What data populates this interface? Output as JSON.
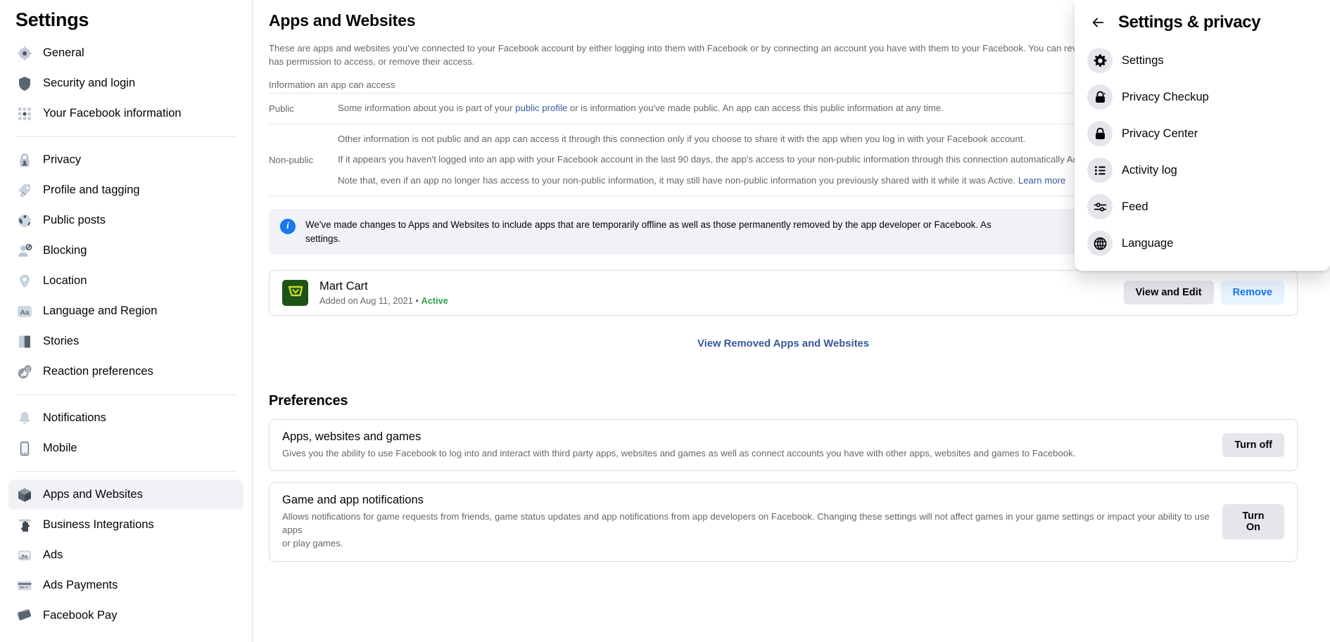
{
  "sidebar": {
    "title": "Settings",
    "groups": [
      {
        "items": [
          {
            "label": "General",
            "icon": "gear-icon"
          },
          {
            "label": "Security and login",
            "icon": "shield-icon"
          },
          {
            "label": "Your Facebook information",
            "icon": "grid-dots-icon"
          }
        ]
      },
      {
        "items": [
          {
            "label": "Privacy",
            "icon": "lock-person-icon"
          },
          {
            "label": "Profile and tagging",
            "icon": "tag-icon"
          },
          {
            "label": "Public posts",
            "icon": "globe-icon"
          },
          {
            "label": "Blocking",
            "icon": "person-block-icon"
          },
          {
            "label": "Location",
            "icon": "map-pin-icon"
          },
          {
            "label": "Language and Region",
            "icon": "aa-text-icon"
          },
          {
            "label": "Stories",
            "icon": "book-icon"
          },
          {
            "label": "Reaction preferences",
            "icon": "thumbs-up-icon"
          }
        ]
      },
      {
        "items": [
          {
            "label": "Notifications",
            "icon": "bell-icon"
          },
          {
            "label": "Mobile",
            "icon": "phone-icon"
          }
        ]
      },
      {
        "items": [
          {
            "label": "Apps and Websites",
            "icon": "cube-icon",
            "active": true
          },
          {
            "label": "Business Integrations",
            "icon": "puzzle-icon"
          },
          {
            "label": "Ads",
            "icon": "ad-image-icon"
          },
          {
            "label": "Ads Payments",
            "icon": "credit-card-icon"
          },
          {
            "label": "Facebook Pay",
            "icon": "wallet-icon"
          }
        ]
      }
    ]
  },
  "main": {
    "page_title": "Apps and Websites",
    "page_description": "These are apps and websites you've connected to your Facebook account by either logging into them with Facebook or by connecting an account you have with them to your Facebook. You can review\nhas permission to access, or remove their access.",
    "info_subhead": "Information an app can access",
    "info_table": {
      "rows": [
        {
          "label": "Public",
          "lines": [
            {
              "pre": "Some information about you is part of your ",
              "link": "public profile",
              "post": " or is information you've made public. An app can access this public information at any time."
            }
          ]
        },
        {
          "label": "Non-public",
          "lines": [
            {
              "pre": "Other information is not public and an app can access it through this connection only if you choose to share it with the app when you log in with your Facebook account.",
              "link": "",
              "post": ""
            },
            {
              "pre": "If it appears you haven't logged into an app with your Facebook account in the last 90 days, the app's access to your non-public information through this connection automatically\nActive to Expired.",
              "link": "",
              "post": ""
            },
            {
              "pre": "Note that, even if an app no longer has access to your non-public information, it may still have non-public information you previously shared with it while it was Active. ",
              "link": "Learn more",
              "post": ""
            }
          ]
        }
      ]
    },
    "banner": {
      "icon": "info-icon",
      "text": "We've made changes to Apps and Websites to include apps that are temporarily offline as well as those permanently removed by the app developer or Facebook. As\nsettings."
    },
    "app": {
      "icon": "shopping-cart-icon",
      "name": "Mart Cart",
      "added": "Added on Aug 11, 2021",
      "separator": "•",
      "status": "Active",
      "view_edit_label": "View and Edit",
      "remove_label": "Remove"
    },
    "view_removed_label": "View Removed Apps and Websites",
    "preferences": {
      "title": "Preferences",
      "items": [
        {
          "name": "Apps, websites and games",
          "desc": "Gives you the ability to use Facebook to log into and interact with third party apps, websites and games as well as connect accounts you have with other apps, websites and games to Facebook.",
          "button": "Turn off"
        },
        {
          "name": "Game and app notifications",
          "desc": "Allows notifications for game requests from friends, game status updates and app notifications from app developers on Facebook. Changing these settings will not affect games in your game settings or impact your ability to use apps\nor play games.",
          "button": "Turn On"
        }
      ]
    }
  },
  "panel": {
    "back_icon": "arrow-left-icon",
    "title": "Settings & privacy",
    "items": [
      {
        "label": "Settings",
        "icon": "gear-icon"
      },
      {
        "label": "Privacy Checkup",
        "icon": "lock-check-icon"
      },
      {
        "label": "Privacy Center",
        "icon": "lock-icon"
      },
      {
        "label": "Activity log",
        "icon": "list-icon"
      },
      {
        "label": "Feed",
        "icon": "sliders-icon"
      },
      {
        "label": "Language",
        "icon": "globe-icon"
      }
    ]
  },
  "colors": {
    "accent_blue": "#1877f2",
    "link_blue": "#385898",
    "status_green": "#31a24c",
    "app_icon_bg": "#1c5416",
    "grey_button": "#e4e6eb"
  }
}
